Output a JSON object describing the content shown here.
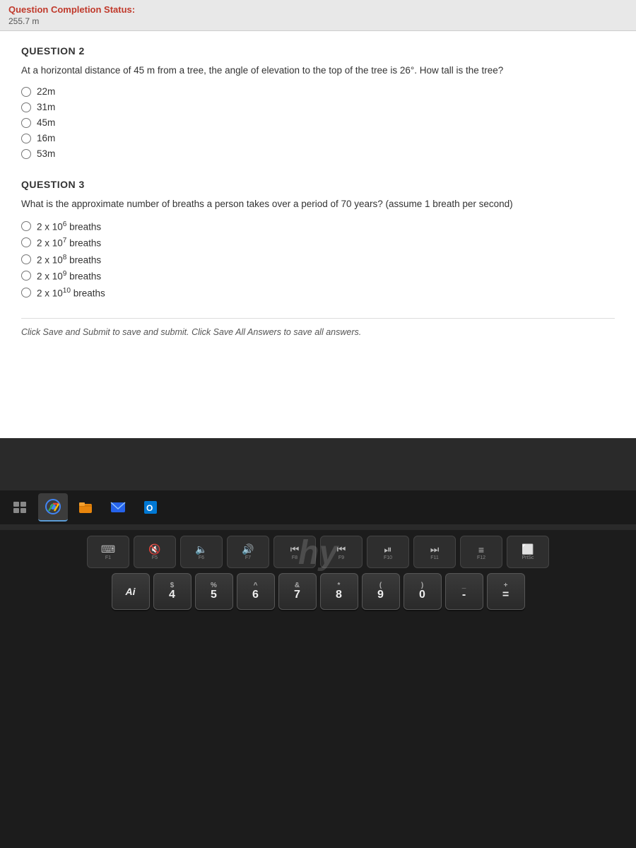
{
  "completion": {
    "label": "Question Completion Status:",
    "value": "255.7 m"
  },
  "question2": {
    "title": "QUESTION 2",
    "text": "At a horizontal distance of 45 m from a tree, the angle of elevation to the top of the tree is 26°. How tall is the tree?",
    "options": [
      "22m",
      "31m",
      "45m",
      "16m",
      "53m"
    ]
  },
  "question3": {
    "title": "QUESTION 3",
    "text": "What is the approximate number of breaths a person takes over a period of 70 years?  (assume 1 breath per second)",
    "options": [
      {
        "base": "2 x 10",
        "exp": "6",
        "suffix": " breaths"
      },
      {
        "base": "2 x 10",
        "exp": "7",
        "suffix": " breaths"
      },
      {
        "base": "2 x 10",
        "exp": "8",
        "suffix": " breaths"
      },
      {
        "base": "2 x 10",
        "exp": "9",
        "suffix": " breaths"
      },
      {
        "base": "2 x 10",
        "exp": "10",
        "suffix": " breaths"
      }
    ]
  },
  "submit_note": "Click Save and Submit to save and submit. Click Save All Answers to save all answers.",
  "taskbar": {
    "buttons": [
      "virtual-desktop",
      "chrome",
      "file-manager",
      "email",
      "outlook"
    ]
  },
  "hp_logo": "hy",
  "keyboard": {
    "fn_keys": [
      {
        "label": "F1",
        "icon": "⌨"
      },
      {
        "label": "F5",
        "icon": "🔇"
      },
      {
        "label": "F6",
        "icon": "🔈"
      },
      {
        "label": "F7",
        "icon": "🔉"
      },
      {
        "label": "F8",
        "icon": "🔊"
      },
      {
        "label": "F9",
        "icon": "⏮"
      },
      {
        "label": "F10",
        "icon": "⏯"
      },
      {
        "label": "F11",
        "icon": "⏭"
      },
      {
        "label": "F12",
        "icon": "≡"
      },
      {
        "label": "PrtSc",
        "icon": "⬜"
      }
    ],
    "row1": [
      {
        "top": "$",
        "main": "4"
      },
      {
        "top": "%",
        "main": "5"
      },
      {
        "top": "^",
        "main": "6"
      },
      {
        "top": "&",
        "main": "7"
      },
      {
        "top": "*",
        "main": "8"
      },
      {
        "top": "(",
        "main": "9"
      },
      {
        "top": ")",
        "main": "0"
      },
      {
        "top": "_",
        "main": "-"
      },
      {
        "top": "+",
        "main": "="
      }
    ]
  }
}
